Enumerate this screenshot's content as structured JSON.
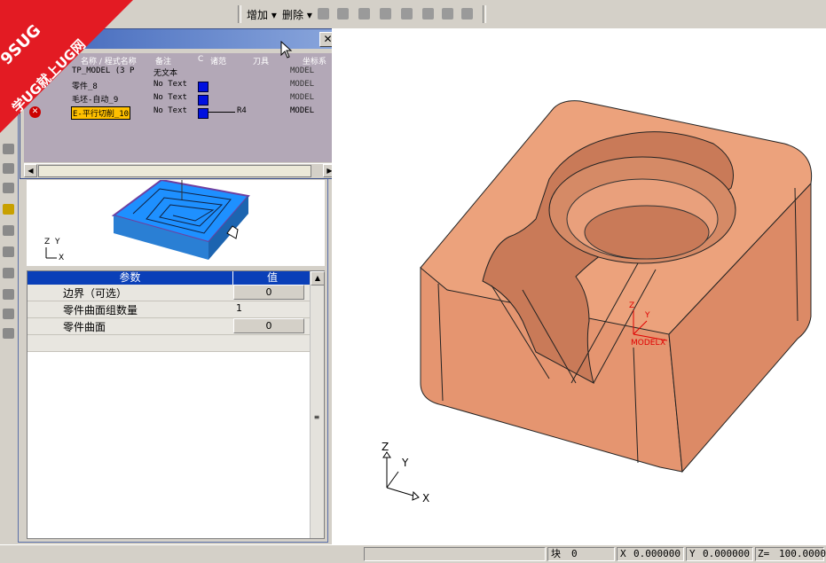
{
  "toolbar": {
    "add_label": "增加",
    "delete_label": "删除"
  },
  "watermark": {
    "line1": "9SUG",
    "line2": "学UG就上UG网",
    "color": "#e31b23"
  },
  "navigator": {
    "columns": [
      "名称 / 程式名称",
      "备注",
      "C",
      "诸范",
      "刀具",
      "坐标系"
    ],
    "rows": [
      {
        "name": "TP_MODEL (3 P",
        "note": "无文本",
        "csys": "MODEL",
        "selected": false
      },
      {
        "name": "零件_8",
        "note": "No Text",
        "csys": "MODEL",
        "selected": false
      },
      {
        "name": "毛坯-自动_9",
        "note": "No Text",
        "csys": "MODEL",
        "selected": false
      },
      {
        "name": "E-平行切削_10",
        "note": "No Text",
        "tool": "R4",
        "csys": "MODEL",
        "selected": true
      }
    ]
  },
  "preview": {
    "axis_z": "Z",
    "axis_y": "Y",
    "axis_x": "X"
  },
  "params": {
    "header_param": "参数",
    "header_value": "值",
    "rows": [
      {
        "label": "边界（可选）",
        "value": "0",
        "kind": "button"
      },
      {
        "label": "零件曲面组数量",
        "value": "1",
        "kind": "text"
      },
      {
        "label": "零件曲面",
        "value": "0",
        "kind": "button"
      }
    ]
  },
  "viewport": {
    "model_axis_z": "Z",
    "model_axis_y": "Y",
    "model_label": "MODEL",
    "model_axis_x": "X",
    "triad_z": "Z",
    "triad_y": "Y",
    "triad_x": "X",
    "part_color": "#e9967a"
  },
  "status": {
    "block_label": "块",
    "block_value": "0",
    "x_label": "X",
    "x_value": "0.000000",
    "y_label": "Y",
    "y_value": "0.000000",
    "z_label": "Z=",
    "z_value": "100.0000"
  }
}
